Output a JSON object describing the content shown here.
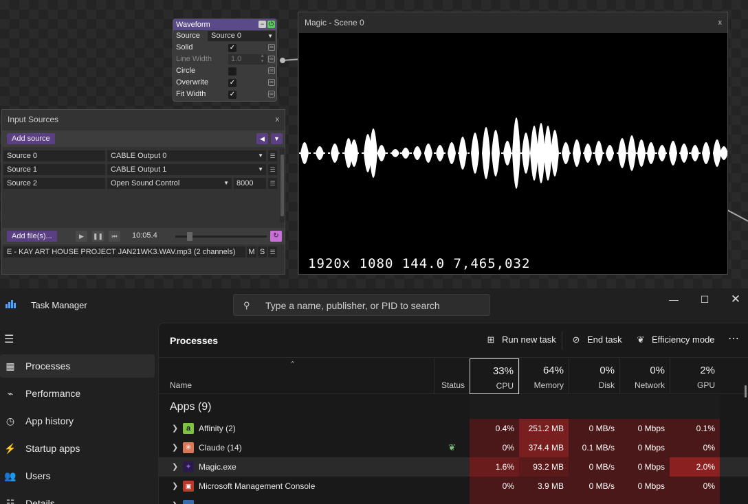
{
  "waveform_node": {
    "title": "Waveform",
    "source_label": "Source",
    "source_value": "Source 0",
    "rows": [
      {
        "label": "Solid",
        "checked": true
      },
      {
        "label": "Line Width",
        "value": "1.0",
        "disabled": true
      },
      {
        "label": "Circle",
        "checked": false
      },
      {
        "label": "Overwrite",
        "checked": true
      },
      {
        "label": "Fit Width",
        "checked": true
      }
    ]
  },
  "input_sources": {
    "title": "Input Sources",
    "close": "x",
    "add_source": "Add source",
    "sources": [
      {
        "name": "Source 0",
        "output": "CABLE Output 0"
      },
      {
        "name": "Source 1",
        "output": "CABLE Output 1"
      },
      {
        "name": "Source 2",
        "output": "Open Sound Control",
        "port": "8000"
      }
    ],
    "add_files": "Add file(s)...",
    "time": "10:05.4",
    "file_name": "E - KAY ART HOUSE PROJECT JAN21WK3.WAV.mp3 (2 channels)",
    "mute": "M",
    "solo": "S"
  },
  "scene": {
    "title": "Magic - Scene 0",
    "close": "x",
    "stats": "1920x 1080   144.0  7,465,032"
  },
  "task_manager": {
    "title": "Task Manager",
    "search_placeholder": "Type a name, publisher, or PID to search",
    "nav": [
      {
        "label": "Processes",
        "icon": "processes-icon",
        "active": true
      },
      {
        "label": "Performance",
        "icon": "performance-icon"
      },
      {
        "label": "App history",
        "icon": "app-history-icon"
      },
      {
        "label": "Startup apps",
        "icon": "startup-apps-icon"
      },
      {
        "label": "Users",
        "icon": "users-icon"
      },
      {
        "label": "Details",
        "icon": "details-icon"
      }
    ],
    "toolbar": {
      "title": "Processes",
      "run_new_task": "Run new task",
      "end_task": "End task",
      "efficiency_mode": "Efficiency mode"
    },
    "columns": {
      "name": "Name",
      "status": "Status",
      "cpu": {
        "pct": "33%",
        "label": "CPU"
      },
      "memory": {
        "pct": "64%",
        "label": "Memory"
      },
      "disk": {
        "pct": "0%",
        "label": "Disk"
      },
      "network": {
        "pct": "0%",
        "label": "Network"
      },
      "gpu": {
        "pct": "2%",
        "label": "GPU"
      }
    },
    "group_title": "Apps (9)",
    "processes": [
      {
        "name": "Affinity (2)",
        "icon": "affinity-icon",
        "cpu": "0.4%",
        "memory": "251.2 MB",
        "disk": "0 MB/s",
        "network": "0 Mbps",
        "gpu": "0.1%"
      },
      {
        "name": "Claude (14)",
        "icon": "claude-icon",
        "efficiency": true,
        "cpu": "0%",
        "memory": "374.4 MB",
        "disk": "0.1 MB/s",
        "network": "0 Mbps",
        "gpu": "0%"
      },
      {
        "name": "Magic.exe",
        "icon": "magic-icon",
        "cpu": "1.6%",
        "memory": "93.2 MB",
        "disk": "0 MB/s",
        "network": "0 Mbps",
        "gpu": "2.0%"
      },
      {
        "name": "Microsoft Management Console",
        "icon": "mmc-icon",
        "cpu": "0%",
        "memory": "3.9 MB",
        "disk": "0 MB/s",
        "network": "0 Mbps",
        "gpu": "0%"
      }
    ]
  },
  "colors": {
    "accent_purple": "#5a3f82",
    "cpu_heat": "#4a1a1a",
    "mem_heat": "#7a1f1f",
    "gpu_hot": "#8a2020"
  }
}
